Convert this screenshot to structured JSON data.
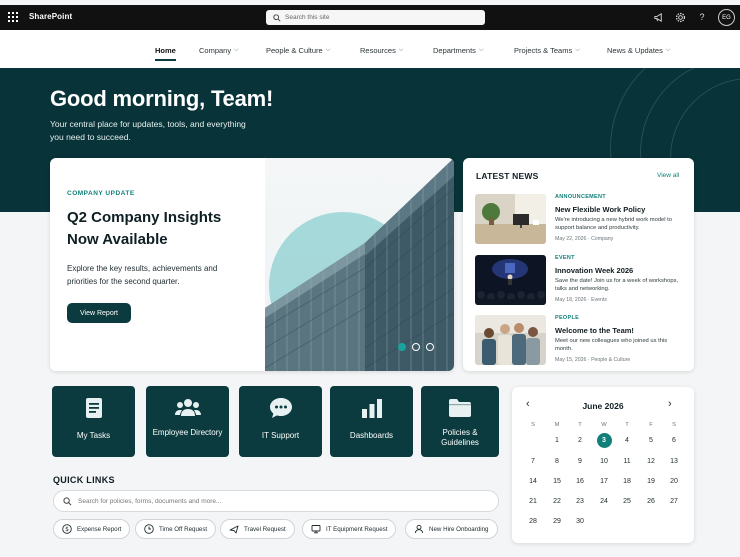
{
  "topbar": {
    "brand": "SharePoint",
    "search_placeholder": "Search this site",
    "avatar_initials": "EG"
  },
  "nav": {
    "items": [
      {
        "label": "Home",
        "active": true
      },
      {
        "label": "Company"
      },
      {
        "label": "People & Culture"
      },
      {
        "label": "Resources"
      },
      {
        "label": "Departments"
      },
      {
        "label": "Projects & Teams"
      },
      {
        "label": "News & Updates"
      }
    ]
  },
  "hero": {
    "title": "Good morning, Team!",
    "subtitle": "Your central place for updates, tools, and everything you need to succeed."
  },
  "feature": {
    "kicker": "COMPANY UPDATE",
    "title": "Q2 Company Insights Now Available",
    "description": "Explore the key results, achievements and priorities for the second quarter.",
    "button": "View Report",
    "slide_count": 3,
    "active_slide": 1
  },
  "news": {
    "heading": "LATEST NEWS",
    "view_all": "View all",
    "items": [
      {
        "category": "ANNOUNCEMENT",
        "title": "New Flexible Work Policy",
        "excerpt": "We're introducing a new hybrid work model to support balance and productivity.",
        "date": "May 22, 2026",
        "tag": "Company"
      },
      {
        "category": "EVENT",
        "title": "Innovation Week 2026",
        "excerpt": "Save the date! Join us for a week of workshops, talks and networking.",
        "date": "May 18, 2026",
        "tag": "Events"
      },
      {
        "category": "PEOPLE",
        "title": "Welcome to the Team!",
        "excerpt": "Meet our new colleagues who joined us this month.",
        "date": "May 15, 2026",
        "tag": "People & Culture"
      }
    ]
  },
  "tiles": [
    {
      "label": "My Tasks",
      "icon": "document-icon"
    },
    {
      "label": "Employee Directory",
      "icon": "people-icon"
    },
    {
      "label": "IT Support",
      "icon": "chat-icon"
    },
    {
      "label": "Dashboards",
      "icon": "bar-chart-icon"
    },
    {
      "label": "Policies & Guidelines",
      "icon": "folder-icon"
    }
  ],
  "quick_links": {
    "title": "QUICK LINKS",
    "search_placeholder": "Search for policies, forms, documents and more...",
    "links": [
      {
        "label": "Expense Report",
        "icon": "dollar-icon"
      },
      {
        "label": "Time Off Request",
        "icon": "clock-icon"
      },
      {
        "label": "Travel Request",
        "icon": "plane-icon"
      },
      {
        "label": "IT Equipment Request",
        "icon": "monitor-icon"
      },
      {
        "label": "New Hire Onboarding",
        "icon": "user-icon"
      }
    ]
  },
  "calendar": {
    "month": "June 2026",
    "weekdays": [
      "S",
      "M",
      "T",
      "W",
      "T",
      "F",
      "S"
    ],
    "start_offset": 1,
    "days_in_month": 30,
    "today": 3
  },
  "colors": {
    "brand_dark": "#0b3b3f",
    "accent": "#12807a",
    "hero_bg": "#083338"
  }
}
